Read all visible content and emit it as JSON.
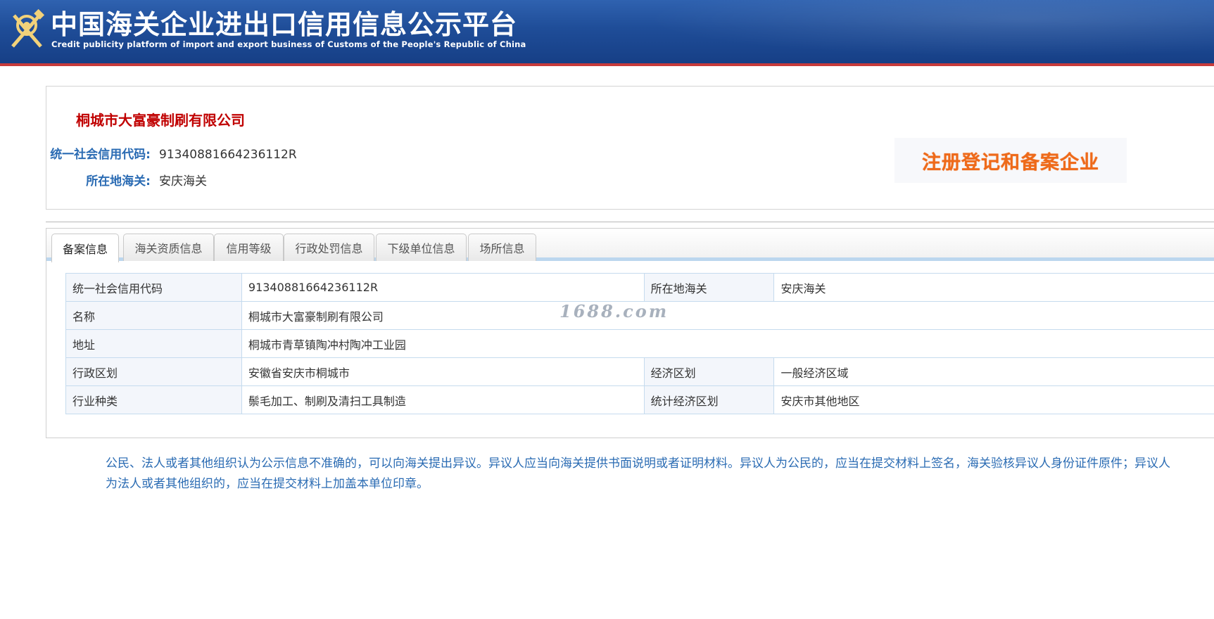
{
  "header": {
    "logo_icon": "customs-emblem-icon",
    "title": "中国海关企业进出口信用信息公示平台",
    "subtitle": "Credit publicity platform of import and export business of Customs of the People's Republic of China"
  },
  "company": {
    "name": "桐城市大富豪制刷有限公司",
    "credit_code_label": "统一社会信用代码:",
    "credit_code": "91340881664236112R",
    "customs_label": "所在地海关:",
    "customs": "安庆海关",
    "status_badge": "注册登记和备案企业"
  },
  "tabs": [
    {
      "label": "备案信息",
      "active": true
    },
    {
      "label": "海关资质信息",
      "active": false
    },
    {
      "label": "信用等级",
      "active": false
    },
    {
      "label": "行政处罚信息",
      "active": false
    },
    {
      "label": "下级单位信息",
      "active": false
    },
    {
      "label": "场所信息",
      "active": false
    }
  ],
  "record": {
    "credit_code_label": "统一社会信用代码",
    "credit_code": "91340881664236112R",
    "customs_label": "所在地海关",
    "customs": "安庆海关",
    "name_label": "名称",
    "name": "桐城市大富豪制刷有限公司",
    "address_label": "地址",
    "address": "桐城市青草镇陶冲村陶冲工业园",
    "admin_region_label": "行政区划",
    "admin_region": "安徽省安庆市桐城市",
    "economic_zone_label": "经济区划",
    "economic_zone": "一般经济区域",
    "industry_label": "行业种类",
    "industry": "鬃毛加工、制刷及清扫工具制造",
    "stat_zone_label": "统计经济区划",
    "stat_zone": "安庆市其他地区"
  },
  "notice": "公民、法人或者其他组织认为公示信息不准确的，可以向海关提出异议。异议人应当向海关提供书面说明或者证明材料。异议人为公民的，应当在提交材料上签名，海关验核异议人身份证件原件；异议人为法人或者其他组织的，应当在提交材料上加盖本单位印章。",
  "watermark": "1688.com",
  "colors": {
    "header_blue": "#1f4d98",
    "header_red_line": "#c73b3b",
    "company_name_red": "#c00000",
    "label_blue": "#2a6bb3",
    "badge_orange": "#ee6a1a"
  }
}
